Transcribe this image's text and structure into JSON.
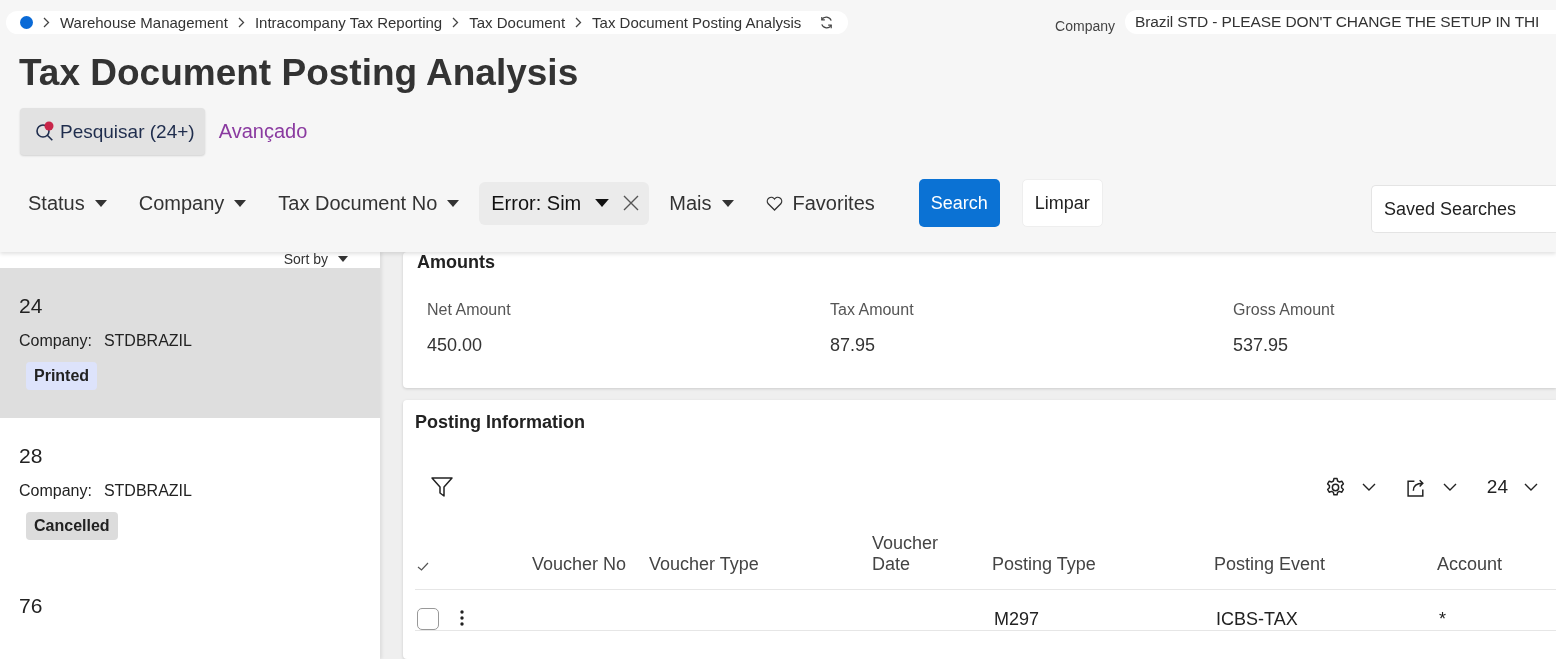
{
  "breadcrumb": [
    "Warehouse Management",
    "Intracompany Tax Reporting",
    "Tax Document",
    "Tax Document Posting Analysis"
  ],
  "company": {
    "label": "Company",
    "value": "Brazil STD - PLEASE DON'T CHANGE THE SETUP IN THI"
  },
  "title": "Tax Document Posting Analysis",
  "search_toggle": {
    "label": "Pesquisar (24+)",
    "advanced": "Avançado"
  },
  "filters": [
    {
      "kind": "dropdown",
      "label": "Status"
    },
    {
      "kind": "dropdown",
      "label": "Company"
    },
    {
      "kind": "dropdown",
      "label": "Tax Document No"
    },
    {
      "kind": "chip",
      "label": "Error: Sim"
    },
    {
      "kind": "dropdown",
      "label": "Mais"
    },
    {
      "kind": "favorites",
      "label": "Favorites"
    }
  ],
  "buttons": {
    "search": "Search",
    "clear": "Limpar"
  },
  "saved_searches": {
    "placeholder": "Saved Searches"
  },
  "list": {
    "sort_label": "Sort by",
    "items": [
      {
        "number": "24",
        "company_label": "Company:",
        "company": "STDBRAZIL",
        "status": "Printed",
        "color": "#dde3fb",
        "selected": true
      },
      {
        "number": "28",
        "company_label": "Company:",
        "company": "STDBRAZIL",
        "status": "Cancelled",
        "color": "#dcdcdc",
        "selected": false
      },
      {
        "number": "76",
        "selected": false
      }
    ]
  },
  "amounts": {
    "title": "Amounts",
    "fields": [
      {
        "label": "Net Amount",
        "value": "450.00"
      },
      {
        "label": "Tax Amount",
        "value": "87.95"
      },
      {
        "label": "Gross Amount",
        "value": "537.95"
      }
    ]
  },
  "posting": {
    "title": "Posting Information",
    "page_size": "24",
    "columns": [
      "Voucher No",
      "Voucher Type",
      "Voucher Date",
      "Posting Type",
      "Posting Event",
      "Account"
    ],
    "rows": [
      {
        "checked": false,
        "posting_type": "M297",
        "posting_event": "ICBS-TAX",
        "account": "*"
      }
    ]
  }
}
